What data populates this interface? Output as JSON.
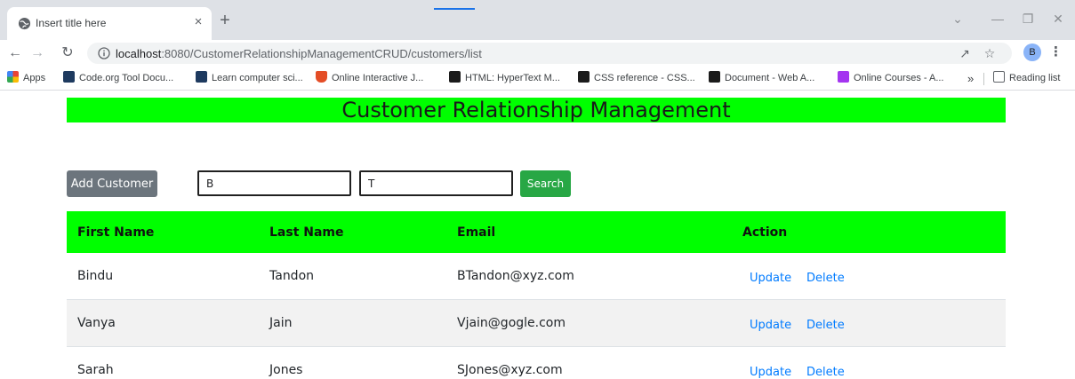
{
  "browser": {
    "tab_title": "Insert title here",
    "tab_close": "×",
    "new_tab": "+",
    "url_host": "localhost",
    "url_rest": ":8080/CustomerRelationshipManagementCRUD/customers/list",
    "avatar_initial": "B",
    "bookmarks": [
      {
        "label": "Apps",
        "icon": "apps-grid-icon",
        "color": "#ea4335"
      },
      {
        "label": "Code.org Tool Docu...",
        "icon": "code-org-icon",
        "color": "#1e3a5f"
      },
      {
        "label": "Learn computer sci...",
        "icon": "code-org-icon",
        "color": "#1e3a5f"
      },
      {
        "label": "Online Interactive J...",
        "icon": "html5-icon",
        "color": "#e44d26"
      },
      {
        "label": "HTML: HyperText M...",
        "icon": "mdn-icon",
        "color": "#1b1b1b"
      },
      {
        "label": "CSS reference - CSS...",
        "icon": "mdn-icon",
        "color": "#1b1b1b"
      },
      {
        "label": "Document - Web A...",
        "icon": "mdn-icon",
        "color": "#1b1b1b"
      },
      {
        "label": "Online Courses - A...",
        "icon": "udemy-icon",
        "color": "#a435f0"
      }
    ],
    "more_bookmarks": "»",
    "reading_list": "Reading list"
  },
  "page": {
    "title": "Customer Relationship Management",
    "add_button": "Add Customer",
    "search_first_value": "B",
    "search_last_value": "T",
    "search_button": "Search",
    "columns": [
      "First Name",
      "Last Name",
      "Email",
      "Action"
    ],
    "rows": [
      {
        "first": "Bindu",
        "last": "Tandon",
        "email": "BTandon@xyz.com"
      },
      {
        "first": "Vanya",
        "last": "Jain",
        "email": "Vjain@gogle.com"
      },
      {
        "first": "Sarah",
        "last": "Jones",
        "email": "SJones@xyz.com"
      }
    ],
    "update_label": "Update",
    "delete_label": "Delete"
  },
  "colors": {
    "banner": "#00ff00",
    "add_button": "#6c757d",
    "search_button": "#28a745",
    "link": "#007bff"
  }
}
